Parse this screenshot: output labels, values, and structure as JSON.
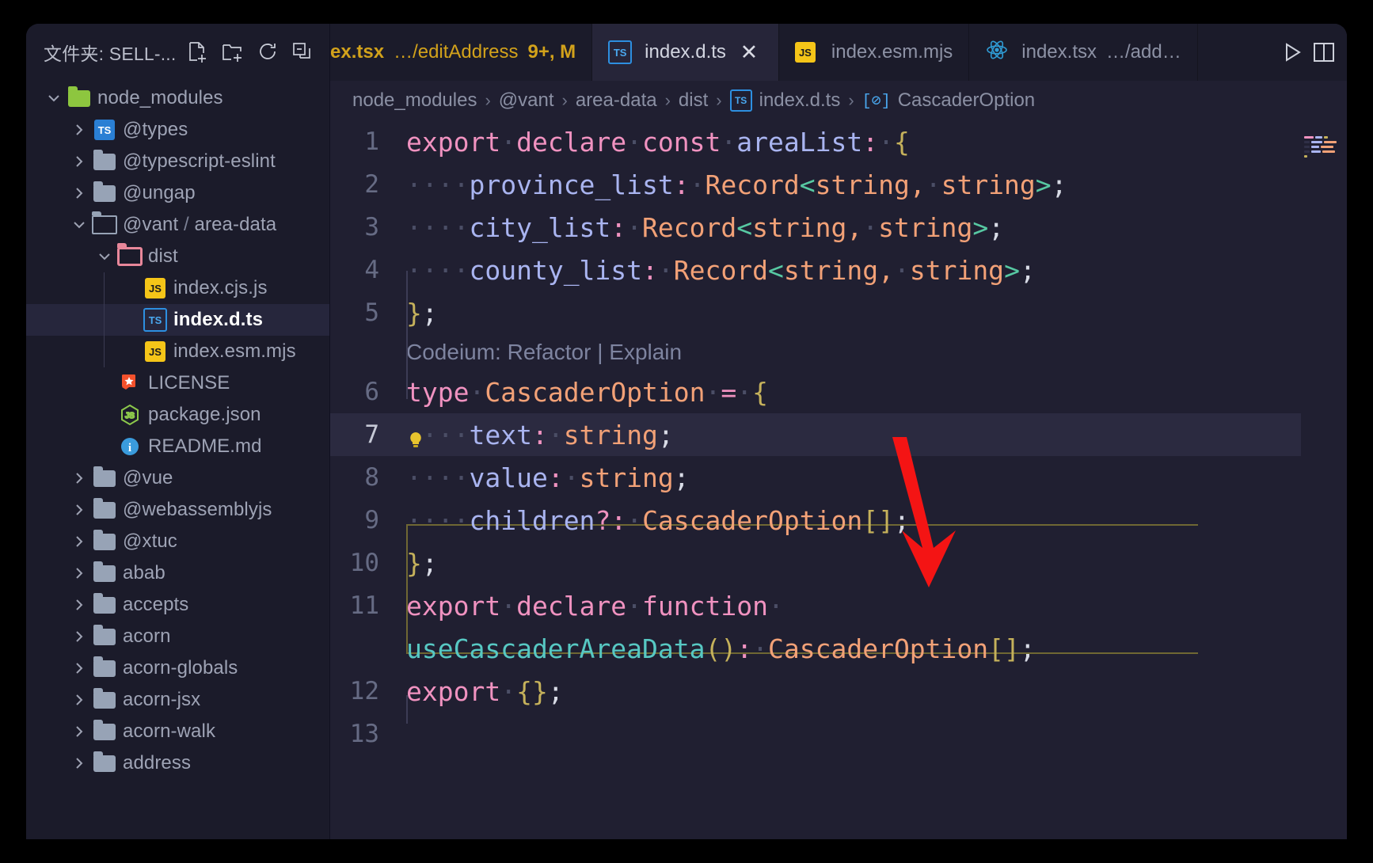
{
  "window": {
    "title_bar_theme": "#1b1b2a"
  },
  "sidebar": {
    "header": {
      "title": "文件夹: SELL-...",
      "actions": [
        {
          "name": "new-file-icon",
          "label": "New File"
        },
        {
          "name": "new-folder-icon",
          "label": "New Folder"
        },
        {
          "name": "refresh-icon",
          "label": "Refresh Explorer"
        },
        {
          "name": "collapse-all-icon",
          "label": "Collapse Folders in Explorer"
        }
      ]
    },
    "tree": [
      {
        "label": "node_modules",
        "indent": 0,
        "twisty": "down",
        "icon": "folder-open-green",
        "selected": false
      },
      {
        "label": "@types",
        "indent": 1,
        "twisty": "right",
        "icon": "ts-solid",
        "selected": false
      },
      {
        "label": "@typescript-eslint",
        "indent": 1,
        "twisty": "right",
        "icon": "folder",
        "selected": false
      },
      {
        "label": "@ungap",
        "indent": 1,
        "twisty": "right",
        "icon": "folder",
        "selected": false
      },
      {
        "label": "@vant",
        "label2": " / ",
        "label3": "area-data",
        "indent": 1,
        "twisty": "down",
        "icon": "folder-open",
        "selected": false
      },
      {
        "label": "dist",
        "indent": 2,
        "twisty": "down",
        "icon": "folder-open-pink",
        "selected": false
      },
      {
        "label": "index.cjs.js",
        "indent": 3,
        "twisty": "none",
        "icon": "js",
        "selected": false
      },
      {
        "label": "index.d.ts",
        "indent": 3,
        "twisty": "none",
        "icon": "ts-outline",
        "selected": true
      },
      {
        "label": "index.esm.mjs",
        "indent": 3,
        "twisty": "none",
        "icon": "js",
        "selected": false
      },
      {
        "label": "LICENSE",
        "indent": 2,
        "twisty": "none",
        "icon": "license",
        "selected": false
      },
      {
        "label": "package.json",
        "indent": 2,
        "twisty": "none",
        "icon": "nodejs",
        "selected": false
      },
      {
        "label": "README.md",
        "indent": 2,
        "twisty": "none",
        "icon": "info",
        "selected": false
      },
      {
        "label": "@vue",
        "indent": 1,
        "twisty": "right",
        "icon": "folder",
        "selected": false
      },
      {
        "label": "@webassemblyjs",
        "indent": 1,
        "twisty": "right",
        "icon": "folder",
        "selected": false
      },
      {
        "label": "@xtuc",
        "indent": 1,
        "twisty": "right",
        "icon": "folder",
        "selected": false
      },
      {
        "label": "abab",
        "indent": 1,
        "twisty": "right",
        "icon": "folder",
        "selected": false
      },
      {
        "label": "accepts",
        "indent": 1,
        "twisty": "right",
        "icon": "folder",
        "selected": false
      },
      {
        "label": "acorn",
        "indent": 1,
        "twisty": "right",
        "icon": "folder",
        "selected": false
      },
      {
        "label": "acorn-globals",
        "indent": 1,
        "twisty": "right",
        "icon": "folder",
        "selected": false
      },
      {
        "label": "acorn-jsx",
        "indent": 1,
        "twisty": "right",
        "icon": "folder",
        "selected": false
      },
      {
        "label": "acorn-walk",
        "indent": 1,
        "twisty": "right",
        "icon": "folder",
        "selected": false
      },
      {
        "label": "address",
        "indent": 1,
        "twisty": "right",
        "icon": "folder",
        "selected": false
      }
    ]
  },
  "tabs": [
    {
      "name": "tab-index-tsx-edit-address",
      "icon": "react-icon",
      "label": "ex.tsx",
      "sub": "…/editAddress",
      "extra": "9+, M",
      "active": false,
      "modified": true,
      "close": false
    },
    {
      "name": "tab-index-d-ts",
      "icon": "ts-outline",
      "label": "index.d.ts",
      "sub": "",
      "extra": "",
      "active": true,
      "modified": false,
      "close": true
    },
    {
      "name": "tab-index-esm-mjs",
      "icon": "js",
      "label": "index.esm.mjs",
      "sub": "",
      "extra": "",
      "active": false,
      "modified": false,
      "close": false
    },
    {
      "name": "tab-index-tsx-add",
      "icon": "react-icon",
      "label": "index.tsx",
      "sub": "…/add…",
      "extra": "",
      "active": false,
      "modified": false,
      "close": false
    }
  ],
  "tab_actions": [
    {
      "name": "run-file-icon",
      "label": "Run"
    },
    {
      "name": "split-editor-icon",
      "label": "Split Editor"
    }
  ],
  "breadcrumb": [
    {
      "label": "node_modules",
      "icon": ""
    },
    {
      "label": "@vant",
      "icon": ""
    },
    {
      "label": "area-data",
      "icon": ""
    },
    {
      "label": "dist",
      "icon": ""
    },
    {
      "label": "index.d.ts",
      "icon": "ts-outline"
    },
    {
      "label": "CascaderOption",
      "icon": "interface-symbol"
    }
  ],
  "editor": {
    "language": "typescript",
    "file": "index.d.ts",
    "current_line": 7,
    "codelens": {
      "line_above": 6,
      "text": "Codeium: Refactor | Explain",
      "actions": [
        "Refactor",
        "Explain"
      ]
    },
    "lightbulb": {
      "line": 7,
      "icon": "lightbulb-icon",
      "color": "#e7c32e"
    },
    "lines": [
      {
        "number": "1",
        "tokens": [
          {
            "t": "export",
            "c": "kw"
          },
          {
            "t": "·",
            "c": "dot"
          },
          {
            "t": "declare",
            "c": "kw"
          },
          {
            "t": "·",
            "c": "dot"
          },
          {
            "t": "const",
            "c": "kw"
          },
          {
            "t": "·",
            "c": "dot"
          },
          {
            "t": "areaList",
            "c": "id"
          },
          {
            "t": ":",
            "c": "op"
          },
          {
            "t": "·",
            "c": "dot"
          },
          {
            "t": "{",
            "c": "brc"
          }
        ]
      },
      {
        "number": "2",
        "tokens": [
          {
            "t": "····",
            "c": "dot"
          },
          {
            "t": "province_list",
            "c": "id"
          },
          {
            "t": ":",
            "c": "op"
          },
          {
            "t": "·",
            "c": "dot"
          },
          {
            "t": "Record",
            "c": "typ"
          },
          {
            "t": "<",
            "c": "ang"
          },
          {
            "t": "string",
            "c": "typ"
          },
          {
            "t": ",",
            "c": "typ"
          },
          {
            "t": "·",
            "c": "dot"
          },
          {
            "t": "string",
            "c": "typ"
          },
          {
            "t": ">",
            "c": "ang"
          },
          {
            "t": ";",
            "c": "pun"
          }
        ]
      },
      {
        "number": "3",
        "tokens": [
          {
            "t": "····",
            "c": "dot"
          },
          {
            "t": "city_list",
            "c": "id"
          },
          {
            "t": ":",
            "c": "op"
          },
          {
            "t": "·",
            "c": "dot"
          },
          {
            "t": "Record",
            "c": "typ"
          },
          {
            "t": "<",
            "c": "ang"
          },
          {
            "t": "string",
            "c": "typ"
          },
          {
            "t": ",",
            "c": "typ"
          },
          {
            "t": "·",
            "c": "dot"
          },
          {
            "t": "string",
            "c": "typ"
          },
          {
            "t": ">",
            "c": "ang"
          },
          {
            "t": ";",
            "c": "pun"
          }
        ]
      },
      {
        "number": "4",
        "tokens": [
          {
            "t": "····",
            "c": "dot"
          },
          {
            "t": "county_list",
            "c": "id"
          },
          {
            "t": ":",
            "c": "op"
          },
          {
            "t": "·",
            "c": "dot"
          },
          {
            "t": "Record",
            "c": "typ"
          },
          {
            "t": "<",
            "c": "ang"
          },
          {
            "t": "string",
            "c": "typ"
          },
          {
            "t": ",",
            "c": "typ"
          },
          {
            "t": "·",
            "c": "dot"
          },
          {
            "t": "string",
            "c": "typ"
          },
          {
            "t": ">",
            "c": "ang"
          },
          {
            "t": ";",
            "c": "pun"
          }
        ]
      },
      {
        "number": "5",
        "tokens": [
          {
            "t": "}",
            "c": "brc"
          },
          {
            "t": ";",
            "c": "pun"
          }
        ]
      },
      {
        "number": "6",
        "tokens": [
          {
            "t": "type",
            "c": "kw"
          },
          {
            "t": "·",
            "c": "dot"
          },
          {
            "t": "CascaderOption",
            "c": "typ"
          },
          {
            "t": "·",
            "c": "dot"
          },
          {
            "t": "=",
            "c": "op"
          },
          {
            "t": "·",
            "c": "dot"
          },
          {
            "t": "{",
            "c": "brc"
          }
        ]
      },
      {
        "number": "7",
        "current": true,
        "tokens": [
          {
            "t": "····",
            "c": "dot"
          },
          {
            "t": "text",
            "c": "id"
          },
          {
            "t": ":",
            "c": "op"
          },
          {
            "t": "·",
            "c": "dot"
          },
          {
            "t": "string",
            "c": "typ"
          },
          {
            "t": ";",
            "c": "pun"
          }
        ]
      },
      {
        "number": "8",
        "tokens": [
          {
            "t": "····",
            "c": "dot"
          },
          {
            "t": "value",
            "c": "id"
          },
          {
            "t": ":",
            "c": "op"
          },
          {
            "t": "·",
            "c": "dot"
          },
          {
            "t": "string",
            "c": "typ"
          },
          {
            "t": ";",
            "c": "pun"
          }
        ]
      },
      {
        "number": "9",
        "tokens": [
          {
            "t": "····",
            "c": "dot"
          },
          {
            "t": "children",
            "c": "id"
          },
          {
            "t": "?",
            "c": "op"
          },
          {
            "t": ":",
            "c": "op"
          },
          {
            "t": "·",
            "c": "dot"
          },
          {
            "t": "CascaderOption",
            "c": "typ"
          },
          {
            "t": "[]",
            "c": "brc"
          },
          {
            "t": ";",
            "c": "pun"
          }
        ]
      },
      {
        "number": "10",
        "tokens": [
          {
            "t": "}",
            "c": "brc"
          },
          {
            "t": ";",
            "c": "pun"
          }
        ]
      },
      {
        "number": "11",
        "tokens": [
          {
            "t": "export",
            "c": "kw"
          },
          {
            "t": "·",
            "c": "dot"
          },
          {
            "t": "declare",
            "c": "kw"
          },
          {
            "t": "·",
            "c": "dot"
          },
          {
            "t": "function",
            "c": "kw"
          },
          {
            "t": "·",
            "c": "dot"
          }
        ]
      },
      {
        "number": "",
        "wrapped": true,
        "tokens": [
          {
            "t": "useCascaderAreaData",
            "c": "fn"
          },
          {
            "t": "()",
            "c": "brc"
          },
          {
            "t": ":",
            "c": "op"
          },
          {
            "t": "·",
            "c": "dot"
          },
          {
            "t": "CascaderOption",
            "c": "typ"
          },
          {
            "t": "[]",
            "c": "brc"
          },
          {
            "t": ";",
            "c": "pun"
          }
        ]
      },
      {
        "number": "12",
        "tokens": [
          {
            "t": "export",
            "c": "kw"
          },
          {
            "t": "·",
            "c": "dot"
          },
          {
            "t": "{}",
            "c": "brc"
          },
          {
            "t": ";",
            "c": "pun"
          }
        ]
      },
      {
        "number": "13",
        "tokens": []
      }
    ]
  },
  "annotation": {
    "type": "arrow",
    "color": "#f41414",
    "points_to": "line-7-text-property"
  },
  "colors": {
    "background": "#201f31",
    "sidebar_bg": "#1b1b2a",
    "selection": "#26263c",
    "current_line": "#2b2a40",
    "keyword": "#f092c0",
    "identifier": "#a9b4f0",
    "type": "#f2a177",
    "function": "#57c8c3",
    "bracket": "#c5b15b",
    "modified_tab": "#d2a21b"
  }
}
